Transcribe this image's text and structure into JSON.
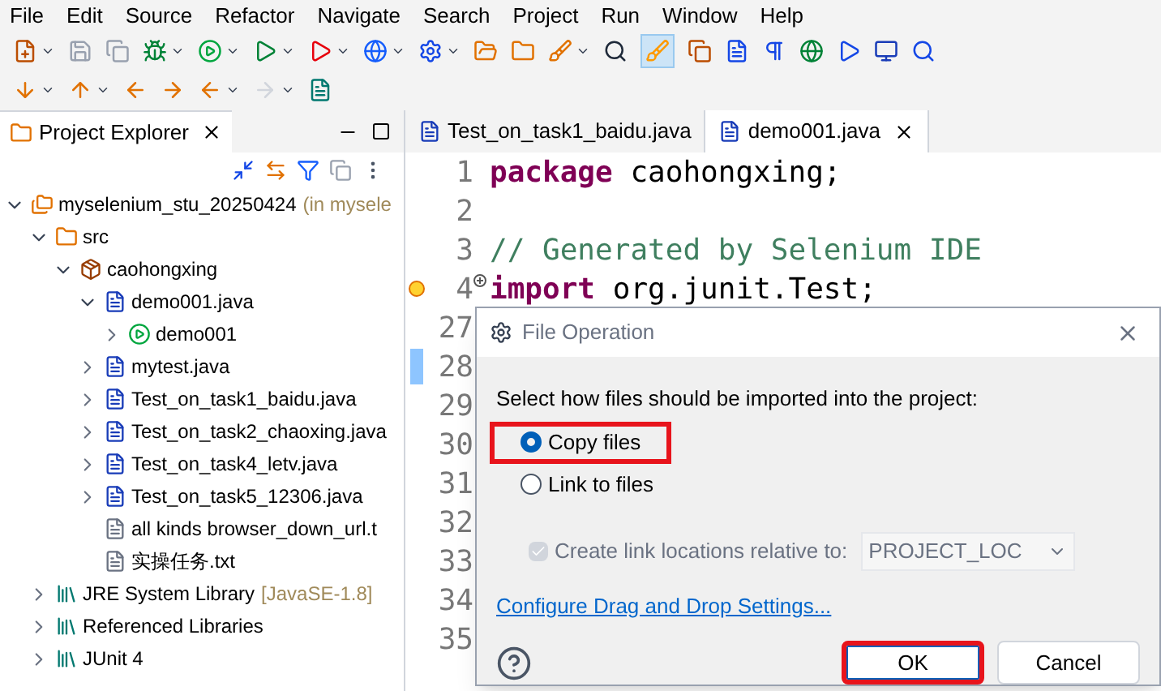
{
  "menu": [
    "File",
    "Edit",
    "Source",
    "Refactor",
    "Navigate",
    "Search",
    "Project",
    "Run",
    "Window",
    "Help"
  ],
  "explorer": {
    "title": "Project Explorer",
    "tree": [
      {
        "label": "myselenium_stu_20250424",
        "suffix": "(in mysele",
        "kind": "project",
        "expanded": true,
        "children": [
          {
            "label": "src",
            "kind": "source",
            "expanded": true,
            "children": [
              {
                "label": "caohongxing",
                "kind": "package",
                "expanded": true,
                "children": [
                  {
                    "label": "demo001.java",
                    "kind": "java",
                    "expanded": true,
                    "children": [
                      {
                        "label": "demo001",
                        "kind": "class",
                        "expanded": false
                      }
                    ]
                  },
                  {
                    "label": "mytest.java",
                    "kind": "java",
                    "expanded": false
                  },
                  {
                    "label": "Test_on_task1_baidu.java",
                    "kind": "java",
                    "expanded": false
                  },
                  {
                    "label": "Test_on_task2_chaoxing.java",
                    "kind": "java",
                    "expanded": false
                  },
                  {
                    "label": "Test_on_task4_letv.java",
                    "kind": "java",
                    "expanded": false
                  },
                  {
                    "label": "Test_on_task5_12306.java",
                    "kind": "java",
                    "expanded": false
                  },
                  {
                    "label": "all kinds browser_down_url.t",
                    "kind": "text"
                  },
                  {
                    "label": "实操任务.txt",
                    "kind": "text"
                  }
                ]
              }
            ]
          },
          {
            "label": "JRE System Library",
            "suffix": "[JavaSE-1.8]",
            "kind": "library",
            "expanded": false
          },
          {
            "label": "Referenced Libraries",
            "kind": "library",
            "expanded": false
          },
          {
            "label": "JUnit 4",
            "kind": "library",
            "expanded": false
          }
        ]
      }
    ]
  },
  "editor_tabs": [
    {
      "label": "Test_on_task1_baidu.java",
      "selected": false
    },
    {
      "label": "demo001.java",
      "selected": true
    }
  ],
  "code_lines": [
    {
      "number": "1",
      "tokens": [
        {
          "kind": "keyword",
          "text": "package"
        },
        {
          "kind": "plain",
          "text": " caohongxing;"
        }
      ]
    },
    {
      "number": "2"
    },
    {
      "number": "3",
      "tokens": [
        {
          "kind": "comment",
          "text": "// Generated by Selenium IDE"
        }
      ]
    },
    {
      "number": "4",
      "folded": true,
      "warning": true,
      "tokens": [
        {
          "kind": "keyword",
          "text": "import"
        },
        {
          "kind": "plain",
          "text": " org.junit.Test;"
        }
      ]
    },
    {
      "number": "27"
    },
    {
      "number": "28",
      "marked": true
    },
    {
      "number": "29"
    },
    {
      "number": "30"
    },
    {
      "number": "31"
    },
    {
      "number": "32"
    },
    {
      "number": "33"
    },
    {
      "number": "34"
    },
    {
      "number": "35"
    }
  ],
  "dialog": {
    "title": "File Operation",
    "prompt": "Select how files should be imported into the project:",
    "options": [
      {
        "label": "Copy files",
        "selected": true,
        "highlighted": true
      },
      {
        "label": "Link to files",
        "selected": false,
        "highlighted": false
      }
    ],
    "link_option": {
      "label": "Create link locations relative to:",
      "checked": true,
      "disabled": true
    },
    "location": {
      "value": "PROJECT_LOC",
      "disabled": true
    },
    "link": "Configure Drag and Drop Settings...",
    "buttons": [
      {
        "label": "OK",
        "kind": "primary",
        "highlighted": true
      },
      {
        "label": "Cancel",
        "kind": "secondary",
        "highlighted": false
      }
    ]
  }
}
